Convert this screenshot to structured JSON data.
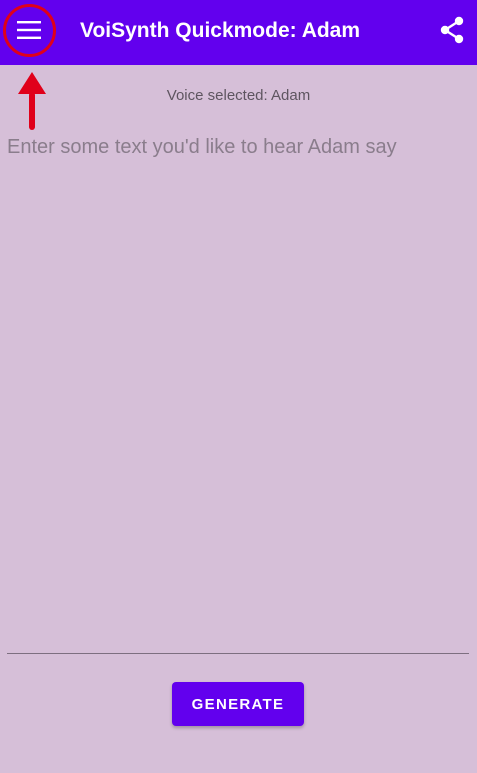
{
  "app_bar": {
    "title": "VoiSynth Quickmode: Adam",
    "menu_icon": "hamburger-menu-icon",
    "share_icon": "share-icon",
    "color": "#6200ee"
  },
  "annotation": {
    "ring_color": "#e0001a",
    "arrow_color": "#e0001a"
  },
  "main": {
    "voice_selected": "Voice selected: Adam",
    "input_placeholder": "Enter some text you'd like to hear Adam say",
    "input_value": "",
    "generate_label": "GENERATE"
  },
  "colors": {
    "background": "#d6bfd8",
    "accent": "#6200ee"
  }
}
